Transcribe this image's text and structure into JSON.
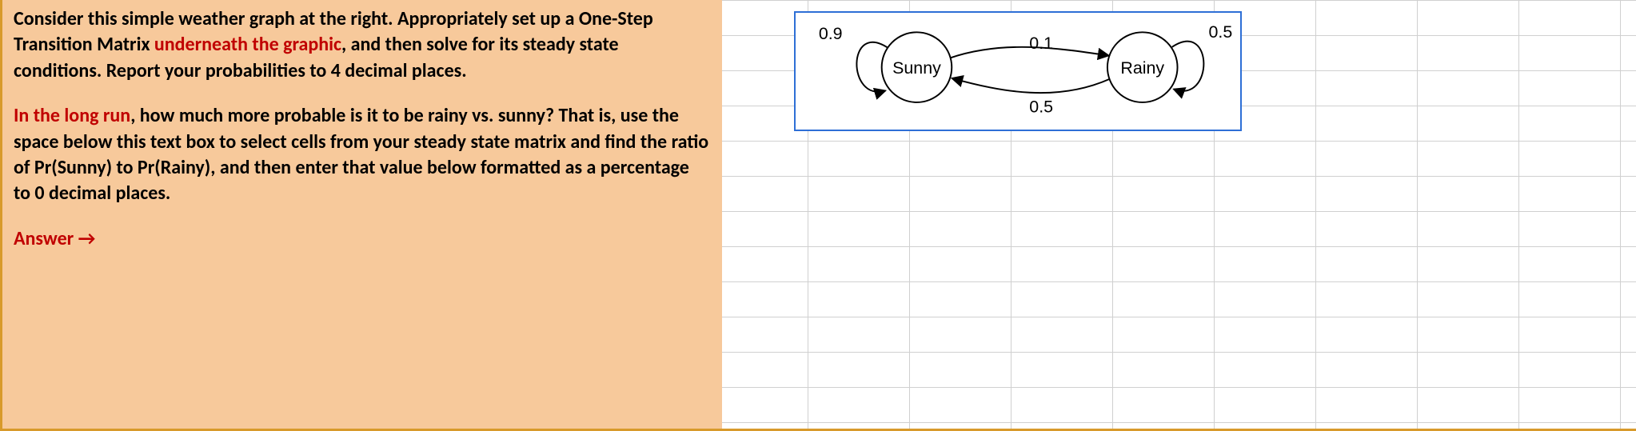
{
  "instructions": {
    "p1_a": "Consider this simple weather graph at the right.  Appropriately set up a One-Step Transition Matrix ",
    "p1_red": "underneath the graphic",
    "p1_b": ", and then solve for its steady state conditions.  Report your probabilities to 4 decimal places.",
    "p2_red": "In the long run",
    "p2_a": ", how much more probable is it to be rainy vs. sunny?  That is, use the space below this text box to select cells from your steady state matrix and find the ratio of Pr(Sunny) to Pr(Rainy), and then enter that value below formatted as a percentage to 0 decimal places.",
    "answer_label": "Answer",
    "answer_arrow": "→"
  },
  "chart_data": {
    "type": "diagram",
    "description": "Markov chain state transition diagram",
    "nodes": [
      {
        "id": "sunny",
        "label": "Sunny"
      },
      {
        "id": "rainy",
        "label": "Rainy"
      }
    ],
    "edges": [
      {
        "from": "sunny",
        "to": "sunny",
        "label": "0.9"
      },
      {
        "from": "sunny",
        "to": "rainy",
        "label": "0.1"
      },
      {
        "from": "rainy",
        "to": "sunny",
        "label": "0.5"
      },
      {
        "from": "rainy",
        "to": "rainy",
        "label": "0.5"
      }
    ]
  }
}
